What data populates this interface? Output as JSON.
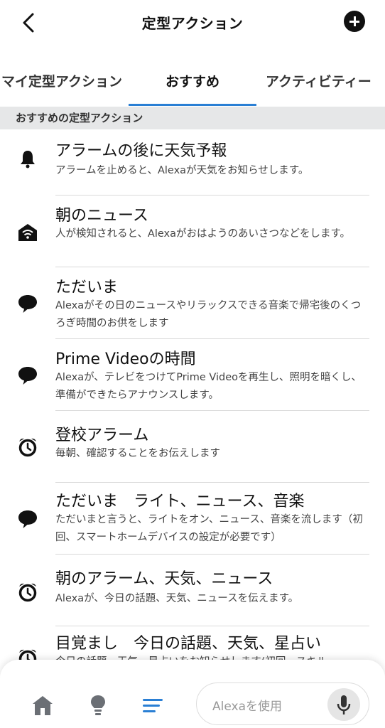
{
  "header": {
    "title": "定型アクション"
  },
  "tabs": [
    {
      "label": "マイ定型アクション"
    },
    {
      "label": "おすすめ"
    },
    {
      "label": "アクティビティー"
    }
  ],
  "section": {
    "title": "おすすめの定型アクション"
  },
  "routines": [
    {
      "icon": "bell-icon",
      "title": "アラームの後に天気予報",
      "desc": "アラームを止めると、Alexaが天気をお知らせします。"
    },
    {
      "icon": "home-wifi-icon",
      "title": "朝のニュース",
      "desc": "人が検知されると、Alexaがおはようのあいさつなどをします。"
    },
    {
      "icon": "speech-bubble-icon",
      "title": "ただいま",
      "desc": "Alexaがその日のニュースやリラックスできる音楽で帰宅後のくつろぎ時間のお供をします"
    },
    {
      "icon": "speech-bubble-icon",
      "title": "Prime Videoの時間",
      "desc": "Alexaが、テレビをつけてPrime Videoを再生し、照明を暗くし、準備ができたらアナウンスします。"
    },
    {
      "icon": "alarm-clock-icon",
      "title": "登校アラーム",
      "desc": "毎朝、確認することをお伝えします"
    },
    {
      "icon": "speech-bubble-icon",
      "title": "ただいま　ライト、ニュース、音楽",
      "desc": "ただいまと言うと、ライトをオン、ニュース、音楽を流します（初回、スマートホームデバイスの設定が必要です）"
    },
    {
      "icon": "alarm-clock-icon",
      "title": "朝のアラーム、天気、ニュース",
      "desc": "Alexaが、今日の話題、天気、ニュースを伝えます。"
    },
    {
      "icon": "alarm-clock-icon",
      "title": "目覚まし　今日の話題、天気、星占い",
      "desc": "今日の話題、天気、星占いをお知らせします(初回、スキル"
    }
  ],
  "bottom_nav": {
    "items": [
      {
        "icon": "home-icon"
      },
      {
        "icon": "lightbulb-icon"
      },
      {
        "icon": "routines-icon"
      }
    ],
    "alexa_placeholder": "Alexaを使用"
  },
  "colors": {
    "accent": "#2a7fd4",
    "section_bg": "#e6e7e8"
  }
}
